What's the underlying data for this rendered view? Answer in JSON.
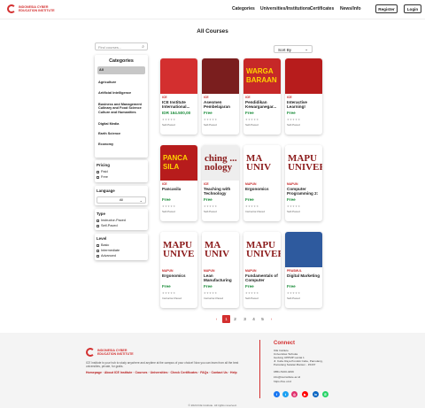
{
  "header": {
    "logo_text": "INDONESIA CYBER EDUCATION INSTITUTE",
    "nav": [
      "Categories",
      "Universities/Institutions",
      "Certificates",
      "News/Info"
    ],
    "register_label": "Register",
    "login_label": "Login"
  },
  "page_title": "All Courses",
  "search": {
    "placeholder": "Find courses..."
  },
  "sort": {
    "selected": "Sort By"
  },
  "filters": {
    "categories_title": "Categories",
    "categories": [
      "All",
      "Agriculture",
      "Artificial Intelligence",
      "Business and Management",
      "Culinary and Food Science",
      "Culture and Humanities",
      "Digital Media",
      "Earth Science",
      "Economy"
    ],
    "pricing_title": "Pricing",
    "pricing": [
      "Paid",
      "Free"
    ],
    "language_title": "Language",
    "language_selected": "All",
    "type_title": "Type",
    "types": [
      "Instructor-Paced",
      "Self-Paced"
    ],
    "level_title": "Level",
    "levels": [
      "Basic",
      "Intermediate",
      "Advanced"
    ]
  },
  "courses": [
    {
      "provider": "ICE",
      "title": "ICE Institute International...",
      "price": "IDR 164.500,00",
      "type": "Self-Paced",
      "thumb_text": "",
      "thumb_bg": "#d32f2f"
    },
    {
      "provider": "ICE",
      "title": "Asesmen Pembelajaran",
      "price": "Free",
      "type": "Self-Paced",
      "thumb_text": "",
      "thumb_bg": "#7a1e1e"
    },
    {
      "provider": "ICE",
      "title": "Pendidikan Kewarganegar...",
      "price": "Free",
      "type": "Self-Paced",
      "thumb_text": "WARGA BARAAN",
      "thumb_bg": "#c62828"
    },
    {
      "provider": "ICE",
      "title": "Interactive Learning!",
      "price": "Free",
      "type": "Self-Paced",
      "thumb_text": "",
      "thumb_bg": "#b71c1c"
    },
    {
      "provider": "ICE",
      "title": "Pancasila",
      "price": "Free",
      "type": "Self-Paced",
      "thumb_text": "PANCA SILA",
      "thumb_bg": "#b71c1c"
    },
    {
      "provider": "ICE",
      "title": "Teaching with Technology",
      "price": "Free",
      "type": "Self-Paced",
      "thumb_text": "ching ... nology",
      "thumb_bg": "#eeeeee"
    },
    {
      "provider": "MAPUN",
      "title": "Ergonomics",
      "price": "Free",
      "type": "Instructor-Paced",
      "thumb_text": "MA UNIV",
      "thumb_bg": "#ffffff"
    },
    {
      "provider": "MAPUN",
      "title": "Computer Programming 2:",
      "price": "Free",
      "type": "Self-Paced",
      "thumb_text": "MAPU UNIVERS",
      "thumb_bg": "#ffffff"
    },
    {
      "provider": "MAPUN",
      "title": "Ergonomics",
      "price": "Free",
      "type": "Instructor-Paced",
      "thumb_text": "MAPU UNIVE",
      "thumb_bg": "#ffffff"
    },
    {
      "provider": "MAPUN",
      "title": "Lean Manufacturing",
      "price": "Free",
      "type": "Instructor-Paced",
      "thumb_text": "MA UNIV",
      "thumb_bg": "#ffffff"
    },
    {
      "provider": "MAPUN",
      "title": "Fundamentals of Computer",
      "price": "Free",
      "type": "Self-Paced",
      "thumb_text": "MAPU UNIVERS",
      "thumb_bg": "#ffffff"
    },
    {
      "provider": "PRASMUL",
      "title": "Digital Marketing",
      "price": "Free",
      "type": "Self-Paced",
      "thumb_text": "",
      "thumb_bg": "#2e5a9e"
    }
  ],
  "pagination": {
    "prev": "‹",
    "pages": [
      "1",
      "2",
      "3",
      "4",
      "5"
    ],
    "next": "›",
    "active": "1"
  },
  "footer": {
    "description": "ICE Institute is your hub to study anywhere and anytime at the campus of your choice! Now you can learn from all the best universities, private, for gratis.",
    "links": "Homepage · About ICE Institute · Courses · Universities · Check Certificates · FAQs · Contact Us · Help",
    "connect_title": "Connect",
    "address": [
      "ICE Institute",
      "Universitas Terbuka",
      "Gedung UPPMP Lantai 1",
      "Jl. Cabe Raya Pondok Cabe, Pamulang,",
      "Pamulang Selatan Banten - 15437",
      "0851-5100-4299",
      "info@iceinstitute.ac.id",
      "https://ice.ut.id"
    ],
    "copyright": "© 2024 ICE Institute. All rights reserved."
  }
}
